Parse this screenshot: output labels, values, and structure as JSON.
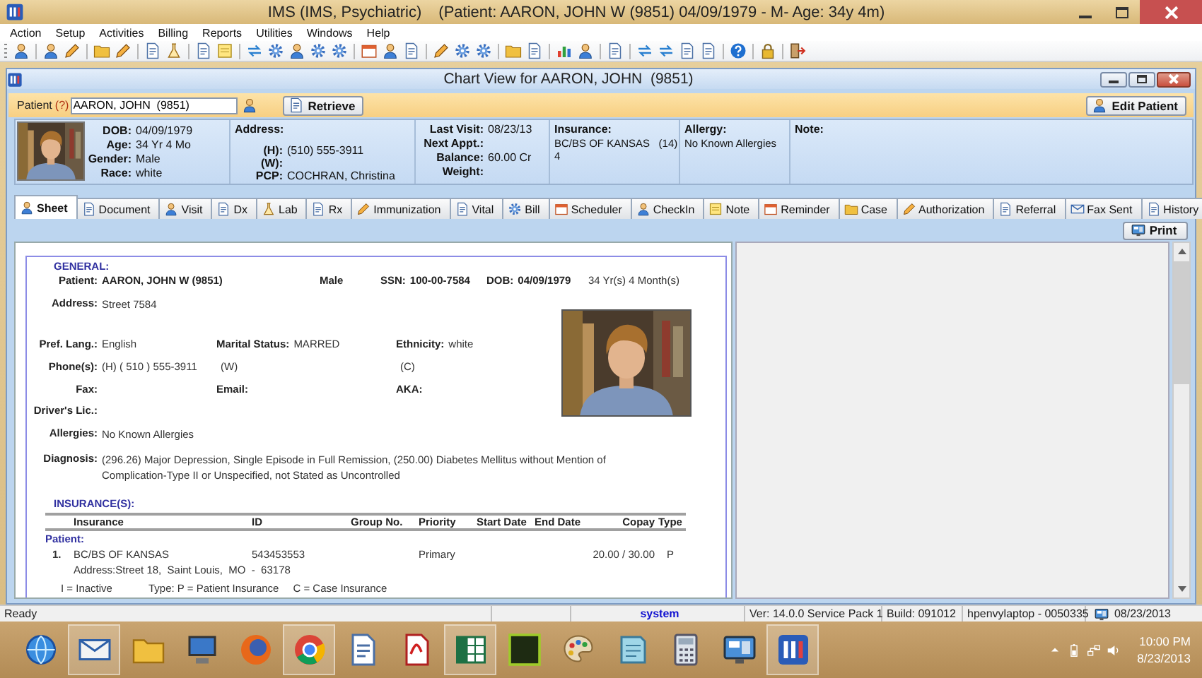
{
  "window": {
    "title": "IMS (IMS, Psychiatric)",
    "patient_caption": "(Patient: AARON, JOHN W (9851) 04/09/1979 - M- Age: 34y 4m)"
  },
  "menu": [
    "Action",
    "Setup",
    "Activities",
    "Billing",
    "Reports",
    "Utilities",
    "Windows",
    "Help"
  ],
  "chart_window": {
    "title": "Chart View for AARON, JOHN  (9851)"
  },
  "patient_bar": {
    "label": "Patient",
    "help": "(?)",
    "value": "AARON, JOHN  (9851)",
    "retrieve_button": "Retrieve",
    "edit_button": "Edit Patient"
  },
  "summary": {
    "columns": [
      {
        "kind": "photo_fields",
        "rows": [
          {
            "label": "DOB:",
            "value": "04/09/1979"
          },
          {
            "label": "Age:",
            "value": "34 Yr 4 Mo"
          },
          {
            "label": "Gender:",
            "value": "Male"
          },
          {
            "label": "Race:",
            "value": "white"
          }
        ]
      },
      {
        "kind": "fields",
        "heading": "Address:",
        "rows": [
          {
            "label": "(H):",
            "value": "(510) 555-3911"
          },
          {
            "label": "(W):"
          },
          {
            "label": "PCP:",
            "value": "COCHRAN, Christina"
          }
        ]
      },
      {
        "kind": "fields",
        "rows": [
          {
            "label": "Last Visit:",
            "value": "08/23/13"
          },
          {
            "label": "Next Appt.:"
          },
          {
            "label": "Balance:",
            "value": "60.00 Cr"
          },
          {
            "label": "Weight:"
          }
        ]
      },
      {
        "kind": "block",
        "heading": "Insurance:",
        "lines": [
          "BC/BS OF KANSAS   (14)",
          "4"
        ]
      },
      {
        "kind": "block",
        "heading": "Allergy:",
        "lines": [
          "No Known Allergies"
        ]
      },
      {
        "kind": "block",
        "heading": "Note:"
      }
    ]
  },
  "tabs": [
    {
      "label": "Sheet",
      "selected": true
    },
    {
      "label": "Document",
      "selected": false
    },
    {
      "label": "Visit",
      "selected": false
    },
    {
      "label": "Dx",
      "selected": false
    },
    {
      "label": "Lab",
      "selected": false
    },
    {
      "label": "Rx",
      "selected": false
    },
    {
      "label": "Immunization",
      "selected": false
    },
    {
      "label": "Vital",
      "selected": false
    },
    {
      "label": "Bill",
      "selected": false
    },
    {
      "label": "Scheduler",
      "selected": false
    },
    {
      "label": "CheckIn",
      "selected": false
    },
    {
      "label": "Note",
      "selected": false
    },
    {
      "label": "Reminder",
      "selected": false
    },
    {
      "label": "Case",
      "selected": false
    },
    {
      "label": "Authorization",
      "selected": false
    },
    {
      "label": "Referral",
      "selected": false
    },
    {
      "label": "Fax Sent",
      "selected": false
    },
    {
      "label": "History",
      "selected": false
    }
  ],
  "print_button": "Print",
  "sheet": {
    "general_heading": "GENERAL:",
    "top_row": [
      {
        "label": "Patient:",
        "value": "AARON, JOHN W  (9851)",
        "bold": true
      },
      {
        "value": "Male",
        "bold": true
      },
      {
        "label": "SSN:",
        "value": "100-00-7584",
        "bold": true
      },
      {
        "label": "DOB:",
        "value": "04/09/1979",
        "bold": true
      },
      {
        "value": "34 Yr(s) 4 Month(s)",
        "bold": false
      }
    ],
    "rows": [
      [
        {
          "label": "Address:",
          "value": "Street 7584"
        }
      ],
      [
        {
          "label": "Pref. Lang.:",
          "value": "English"
        },
        {
          "label": "Marital Status:",
          "value": "MARRED"
        },
        {
          "label": "Ethnicity:",
          "value": "white"
        }
      ],
      [
        {
          "label": "Phone(s):",
          "value": "(H) ( 510 ) 555-3911"
        },
        {
          "value": "(W)"
        },
        {
          "value": "(C)"
        }
      ],
      [
        {
          "label": "Fax:"
        },
        {
          "label": "Email:"
        },
        {
          "label": "AKA:"
        }
      ],
      [
        {
          "label": "Driver's Lic.:"
        }
      ],
      [
        {
          "label": "Allergies:",
          "value": "No Known Allergies"
        }
      ],
      [
        {
          "label": "Diagnosis:",
          "value": "(296.26) Major Depression, Single Episode in Full Remission, (250.00) Diabetes Mellitus without Mention of Complication-Type II or Unspecified, not Stated as Uncontrolled"
        }
      ]
    ],
    "insurance": {
      "heading": "INSURANCE(S):",
      "columns": [
        "Insurance",
        "ID",
        "Group No.",
        "Priority",
        "Start Date",
        "End Date",
        "Copay",
        "Type"
      ],
      "group": "Patient:",
      "rows": [
        {
          "number": "1.",
          "insurance": "BC/BS OF KANSAS",
          "id": "543453553",
          "priority": "Primary",
          "copay": "20.00 / 30.00",
          "type": "P",
          "address": "Address:Street 18,  Saint Louis,  MO  -  63178"
        }
      ],
      "legend": [
        "I = Inactive",
        "Type: P = Patient Insurance",
        "C = Case Insurance"
      ]
    }
  },
  "status_bar": {
    "ready": "Ready",
    "user": "system",
    "version": "Ver: 14.0.0 Service Pack 1",
    "build": "Build: 091012",
    "machine": "hpenvylaptop - 0050335",
    "date": "08/23/2013"
  },
  "taskbar": {
    "apps": [
      {
        "kind": "globe",
        "running": false
      },
      {
        "kind": "envelope",
        "running": true
      },
      {
        "kind": "folder",
        "running": false
      },
      {
        "kind": "computer",
        "running": false
      },
      {
        "kind": "sphere",
        "running": false
      },
      {
        "kind": "wheel",
        "running": true
      },
      {
        "kind": "document",
        "running": false
      },
      {
        "kind": "page",
        "running": false
      },
      {
        "kind": "spreadsheet",
        "running": true
      },
      {
        "kind": "tile",
        "running": false
      },
      {
        "kind": "palette",
        "running": false
      },
      {
        "kind": "notepad",
        "running": false
      },
      {
        "kind": "calculator",
        "running": false
      },
      {
        "kind": "monitor",
        "running": false
      },
      {
        "kind": "app",
        "running": true
      }
    ],
    "time": "10:00 PM",
    "date": "8/23/2013"
  }
}
